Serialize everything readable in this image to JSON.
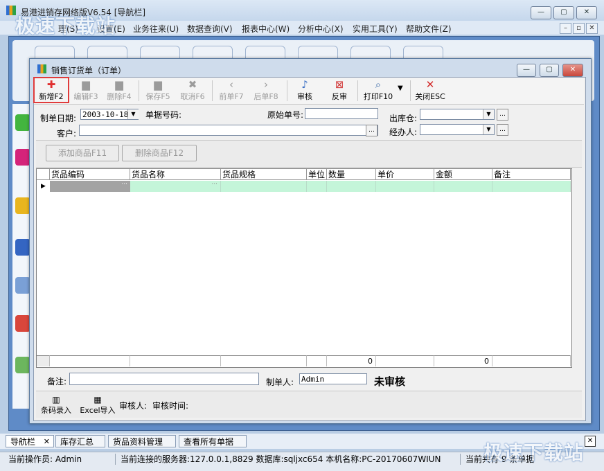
{
  "app": {
    "title": "易港进销存网络版V6.54  [导航栏]",
    "menus": [
      "业务往来(U)",
      "数据查询(V)",
      "报表中心(W)",
      "分析中心(X)",
      "实用工具(Y)",
      "帮助文件(Z)"
    ],
    "partial_menus": [
      "理(S)",
      "设置(E)"
    ]
  },
  "dialog": {
    "title": "销售订货单（订单）",
    "toolbar": {
      "new": "新增F2",
      "edit": "编辑F3",
      "delete": "删除F4",
      "save": "保存F5",
      "cancel": "取消F6",
      "prev": "前单F7",
      "next": "后单F8",
      "audit": "审核",
      "unaudit": "反审",
      "print": "打印F10",
      "close": "关闭ESC"
    },
    "form": {
      "date_label": "制单日期:",
      "date_value": "2003-10-18",
      "docno_label": "单据号码:",
      "origno_label": "原始单号:",
      "warehouse_label": "出库仓:",
      "customer_label": "客户:",
      "handler_label": "经办人:"
    },
    "buttons": {
      "add_goods": "添加商品F11",
      "del_goods": "删除商品F12"
    },
    "grid": {
      "headers": [
        "货品编码",
        "货品名称",
        "货品规格",
        "单位",
        "数量",
        "单价",
        "金额",
        "备注"
      ],
      "footer_qty": "0",
      "footer_amount": "0"
    },
    "remark_label": "备注:",
    "maker_label": "制单人:",
    "maker_value": "Admin",
    "status": "未审核",
    "barcode": "条码录入",
    "excel": "Excel导入",
    "auditor_label": "审核人:",
    "audit_time_label": "审核时间:"
  },
  "tabs": [
    "导航栏",
    "库存汇总",
    "货品资料管理",
    "查看所有单据"
  ],
  "status": {
    "operator": "当前操作员: Admin",
    "server": "当前连接的服务器:127.0.0.1,8829 数据库:sqljxc654 本机名称:PC-20170607WIUN",
    "summary": "当前共有 9 条单据"
  },
  "watermark": "极速下载站"
}
